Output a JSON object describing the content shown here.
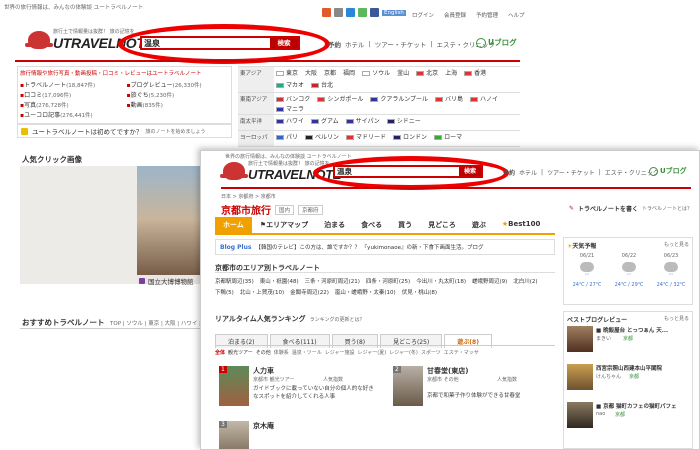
{
  "main": {
    "topbar": {
      "tagline": "世界の旅行情報は、みんなの体験談 ユートラベルノート",
      "lang": "English",
      "links": [
        "ログイン",
        "会員登録",
        "予約管理",
        "ヘルプ"
      ]
    },
    "logo": {
      "tagline": "旅行土で情報量は抜群！ 旅の記憶を",
      "brand": "UTRAVELNOTE"
    },
    "search": {
      "value": "温泉",
      "button": "検索"
    },
    "nav": {
      "reserve": "予約",
      "links": [
        "ホテル",
        "ツアー・チケット",
        "エステ・クリニック"
      ],
      "blog": "Uブログ"
    },
    "info": {
      "heading": "旅行情報や旅行写真・動画投稿・口コミ・レビューはユートラベルノート",
      "stats": [
        {
          "label": "トラベルノート",
          "value": "(18,847件)"
        },
        {
          "label": "ブログレビュー",
          "value": "(26,330件)"
        },
        {
          "label": "口コミ",
          "value": "(17,096件)"
        },
        {
          "label": "旅ぐち",
          "value": "(5,230件)"
        },
        {
          "label": "写真",
          "value": "(276,728件)"
        },
        {
          "label": "動画",
          "value": "(835件)"
        },
        {
          "label": "ユーコロ記事",
          "value": "(276,441件)"
        }
      ]
    },
    "regions": [
      {
        "label": "東アジア",
        "cities": [
          "東京",
          "大阪",
          "京都",
          "福岡",
          "ソウル",
          "釜山",
          "北京",
          "上海",
          "香港",
          "マカオ",
          "台北"
        ]
      },
      {
        "label": "東南アジア",
        "cities": [
          "バンコク",
          "シンガポール",
          "クアラルンプール",
          "バリ島",
          "ハノイ",
          "マニラ"
        ]
      },
      {
        "label": "南太平洋",
        "cities": [
          "ハワイ",
          "グアム",
          "サイパン",
          "シドニー"
        ]
      },
      {
        "label": "ヨーロッパ",
        "cities": [
          "パリ",
          "ベルリン",
          "マドリード",
          "ロンドン",
          "ローマ"
        ]
      }
    ],
    "first_time": "ユートラベルノートは初めてですか？",
    "first_time_sub": "旅のノートを始めましょう",
    "popular_heading": "人気クリック画像",
    "gallery_caption": "国立大博博物館",
    "recommend_heading": "おすすめトラベルノート",
    "recommend_tags": "TOP | ソウル | 東京 | 大阪 | ハワイ | 台湾"
  },
  "sub": {
    "topbar": {
      "tagline": "世界の旅行情報は、みんなの体験談 ユートラベルノート"
    },
    "logo": {
      "tagline": "旅行土で情報量は抜群！ 旅の記憶を",
      "brand": "UTRAVELNOTE"
    },
    "search": {
      "value": "温泉",
      "button": "検索"
    },
    "nav": {
      "reserve": "予約",
      "links": [
        "ホテル",
        "ツアー・チケット",
        "エステ・クリニック"
      ],
      "blog": "Uブログ"
    },
    "breadcrumb": "日本 > 京都府 > 京都市",
    "page_title": "京都市旅行",
    "title_tags": [
      "国内",
      "京都府"
    ],
    "write_link": "トラベルノートを書く",
    "write_sub": "トラベルノートとは？",
    "navbar": [
      "ホーム",
      "エリアマップ",
      "泊まる",
      "食べる",
      "買う",
      "見どころ",
      "遊ぶ",
      "Best100"
    ],
    "blog_plus": {
      "label": "Blog Plus",
      "text": "【韓国のテレビ】この方は、誰ですか？？ 『yukimonaoe』の新・下食下画面生活。ブログ"
    },
    "area_heading": "京都市のエリア別トラベルノート",
    "areas": [
      "京都駅周辺(35)",
      "東山・祇園(48)",
      "三条・河原町周辺(21)",
      "四条・河原町(25)",
      "今出川・丸太町(18)",
      "嵯峨野周辺(9)",
      "北白川(2)",
      "下鴨(5)",
      "北山・上賀茂(10)",
      "金閣寺周辺(22)",
      "嵐山・嵯峨野・太秦(10)",
      "伏見・桃山(8)"
    ],
    "ranking_heading": "リアルタイム人気ランキング",
    "ranking_sub": "ランキングの更新とは？",
    "rank_tabs": [
      "泊まる(2)",
      "食べる(111)",
      "買う(8)",
      "見どころ(25)",
      "遊ぶ(8)"
    ],
    "filter": [
      "全体",
      "観光ツアー",
      "その他",
      "体験系",
      "温泉・ツール",
      "レジャー施設",
      "レジャー(夏)",
      "レジャー(冬)",
      "スポーツ",
      "エステ・マッサ"
    ],
    "items": [
      {
        "rank": "1",
        "name": "人力車",
        "cat": "京都市 観光ツアー",
        "vote": "人気指数",
        "desc": "ガイドブックに載っていない自分の個人的な好きなスポットを紹介してくれる人事"
      },
      {
        "rank": "2",
        "name": "甘春堂(東店)",
        "cat": "京都市 その他",
        "vote": "人気指数",
        "desc": "京都で和菓子作り体験ができる甘春堂"
      },
      {
        "rank": "3",
        "name": "京木庵",
        "cat": "",
        "vote": "",
        "desc": ""
      }
    ],
    "weather": {
      "heading": "天気予報",
      "more": "もっと見る",
      "days": [
        {
          "date": "06/21",
          "temp": "24℃ / 27℃"
        },
        {
          "date": "06/22",
          "temp": "24℃ / 29℃"
        },
        {
          "date": "06/23",
          "temp": "24℃ / 32℃"
        }
      ]
    },
    "best_blog": {
      "heading": "ベストブログレビュー",
      "more": "もっと見る",
      "items": [
        {
          "title": "■ 晩飯屋台 とっつぁん 天...",
          "meta": "京都",
          "who": "まきい"
        },
        {
          "title": "西宮宗照山西建本山平閣院",
          "meta": "京都",
          "who": "けんちゃん"
        },
        {
          "title": "■ 京都 猫町カフェの猫町パフェ",
          "meta": "京都",
          "who": "nao"
        }
      ]
    }
  },
  "colors": {
    "accent": "#c00000",
    "highlight_ring": "#e00000",
    "nav_orange": "#f0a000",
    "blog_green": "#3a8f3a"
  }
}
